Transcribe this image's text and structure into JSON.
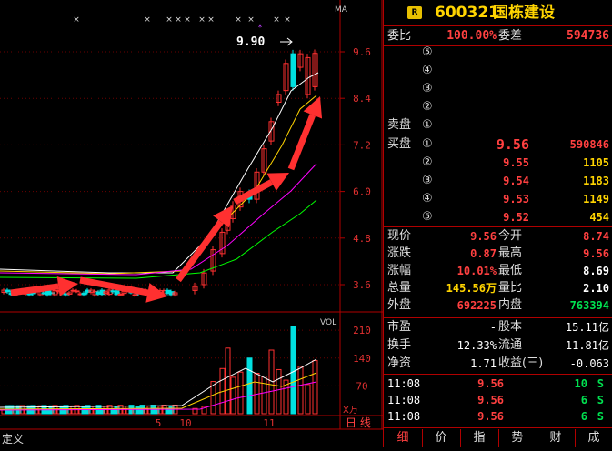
{
  "header": {
    "badge": "R",
    "code": "600321",
    "name": "国栋建设"
  },
  "weibi": {
    "label1": "委比",
    "ratio": "100.00%",
    "label2": "委差",
    "diff": "594736"
  },
  "sell": {
    "label": "卖盘",
    "levels": [
      {
        "n": "⑤",
        "price": "",
        "vol": ""
      },
      {
        "n": "④",
        "price": "",
        "vol": ""
      },
      {
        "n": "③",
        "price": "",
        "vol": ""
      },
      {
        "n": "②",
        "price": "",
        "vol": ""
      },
      {
        "n": "①",
        "price": "",
        "vol": ""
      }
    ]
  },
  "buy": {
    "label": "买盘",
    "levels": [
      {
        "n": "①",
        "price": "9.56",
        "vol": "590846"
      },
      {
        "n": "②",
        "price": "9.55",
        "vol": "1105"
      },
      {
        "n": "③",
        "price": "9.54",
        "vol": "1183"
      },
      {
        "n": "④",
        "price": "9.53",
        "vol": "1149"
      },
      {
        "n": "⑤",
        "price": "9.52",
        "vol": "454"
      }
    ]
  },
  "quote": [
    {
      "l1": "现价",
      "v1": "9.56",
      "l2": "今开",
      "v2": "8.74"
    },
    {
      "l1": "涨跌",
      "v1": "0.87",
      "l2": "最高",
      "v2": "9.56"
    },
    {
      "l1": "涨幅",
      "v1": "10.01%",
      "l2": "最低",
      "v2": "8.69"
    },
    {
      "l1": "总量",
      "v1": "145.56万",
      "l2": "量比",
      "v2": "2.10"
    },
    {
      "l1": "外盘",
      "v1": "692225",
      "l2": "内盘",
      "v2": "763394"
    }
  ],
  "fundamentals": [
    {
      "l1": "市盈",
      "v1": "-",
      "l2": "股本",
      "v2": "15.11亿"
    },
    {
      "l1": "换手",
      "v1": "12.33%",
      "l2": "流通",
      "v2": "11.81亿"
    },
    {
      "l1": "净资",
      "v1": "1.71",
      "l2": "收益(三)",
      "v2": "-0.063"
    }
  ],
  "ticks": [
    {
      "time": "11:08",
      "price": "9.56",
      "vol": "10",
      "side": "S"
    },
    {
      "time": "11:08",
      "price": "9.56",
      "vol": "6",
      "side": "S"
    },
    {
      "time": "11:08",
      "price": "9.56",
      "vol": "6",
      "side": "S"
    }
  ],
  "tabs": [
    "细",
    "价",
    "指",
    "势",
    "财",
    "成"
  ],
  "chart": {
    "ma_label": "MA",
    "vol_label": "VOL",
    "price_ticks": [
      "9.6",
      "8.4",
      "7.2",
      "6.0",
      "4.8",
      "3.6"
    ],
    "vol_ticks": [
      "210",
      "140",
      "70"
    ],
    "vol_unit": "X万",
    "peak_label": "9.90",
    "date_labels": [
      "5",
      "10",
      "11"
    ],
    "period_label": "日 线",
    "left_tab": "定义"
  },
  "colors": {
    "up": "#ff3030",
    "down": "#00e0e0",
    "grid": "#b00000",
    "arrow": "#ff3030"
  }
}
